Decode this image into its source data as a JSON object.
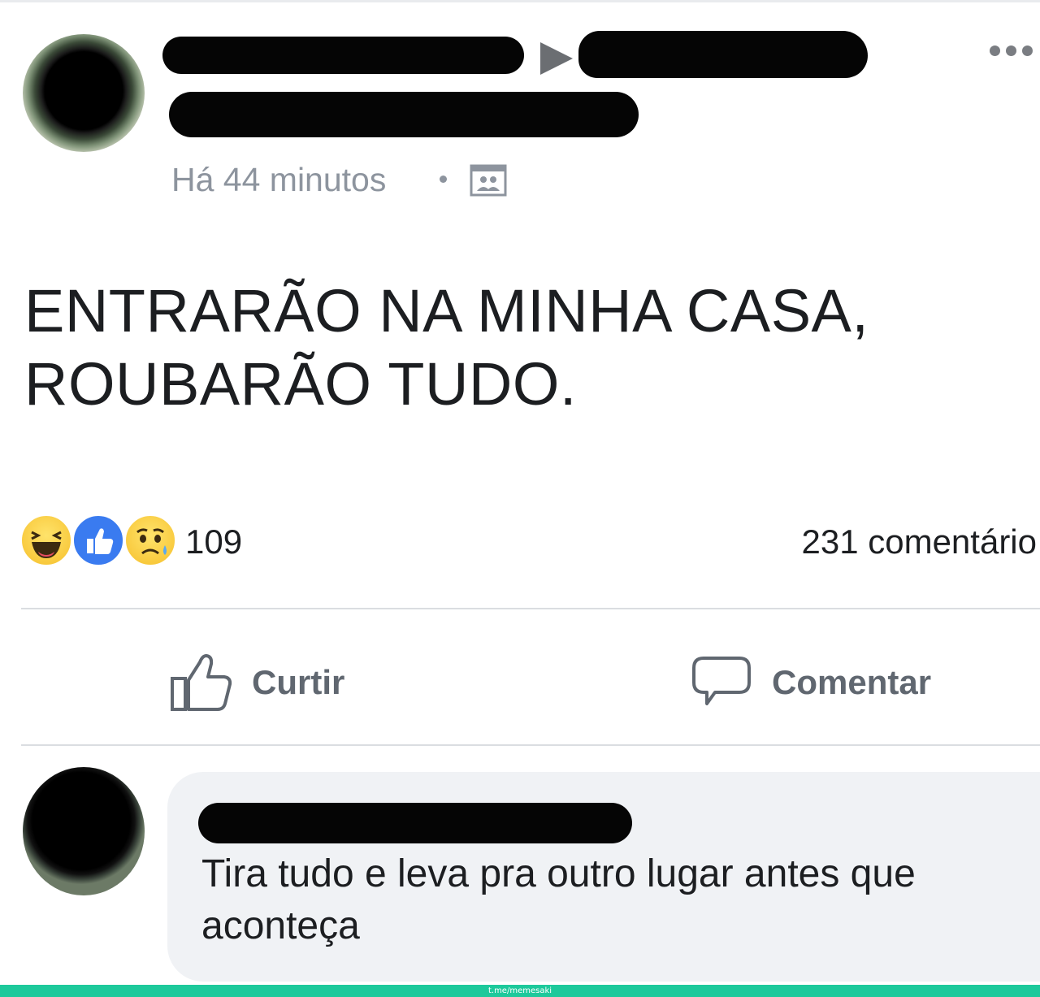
{
  "post": {
    "timestamp": "Há 44 minutos",
    "text_lines": [
      "ENTRARÃO NA MINHA CASA,",
      "ROUBARÃO TUDO."
    ],
    "reaction_count": "109",
    "comment_count": "231 comentário",
    "actions": {
      "like_label": "Curtir",
      "comment_label": "Comentar"
    },
    "icons": {
      "more": "more-options-icon",
      "arrow": "shared-to-arrow-icon",
      "privacy": "privacy-group-icon",
      "reactions": [
        "haha-reaction-icon",
        "like-reaction-icon",
        "sad-reaction-icon"
      ],
      "like_action": "thumbs-up-icon",
      "comment_action": "speech-bubble-icon"
    }
  },
  "comment": {
    "text": "Tira tudo e leva pra outro lugar antes que aconteça"
  },
  "footer": {
    "watermark": "t.me/memesaki"
  },
  "colors": {
    "secondary_text": "#8d949e",
    "action_text": "#606770",
    "like_blue": "#3a7bf0",
    "reaction_yellow": "#f6c02c",
    "footer_green": "#1dc99b",
    "bubble_bg": "#f0f2f5"
  }
}
